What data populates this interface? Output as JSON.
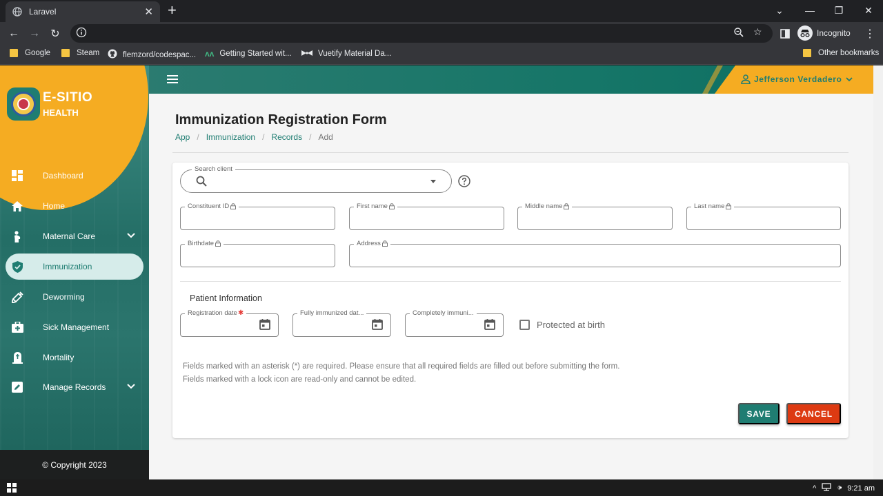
{
  "browser": {
    "tab_title": "Laravel",
    "tab_close": "✕",
    "new_tab": "+",
    "incognito_label": "Incognito",
    "bookmarks": [
      {
        "label": "Google",
        "icon": "folder-icon"
      },
      {
        "label": "Steam",
        "icon": "folder-icon"
      },
      {
        "label": "flemzord/codespac...",
        "icon": "github-icon"
      },
      {
        "label": "Getting Started wit...",
        "icon": "vue-icon"
      },
      {
        "label": "Vuetify Material Da...",
        "icon": "bowtie-icon"
      }
    ],
    "other_bookmarks": "Other bookmarks"
  },
  "sidebar": {
    "brand_name": "E-SITIO",
    "brand_sub": "HEALTH",
    "items": [
      {
        "label": "Dashboard",
        "icon": "dashboard-icon"
      },
      {
        "label": "Home",
        "icon": "home-icon"
      },
      {
        "label": "Maternal Care",
        "icon": "maternal-icon",
        "expandable": true
      },
      {
        "label": "Immunization",
        "icon": "shield-icon",
        "active": true
      },
      {
        "label": "Deworming",
        "icon": "syringe-icon"
      },
      {
        "label": "Sick Management",
        "icon": "medical-bag-icon"
      },
      {
        "label": "Mortality",
        "icon": "tombstone-icon"
      },
      {
        "label": "Manage Records",
        "icon": "edit-icon",
        "expandable": true
      }
    ],
    "copyright": "© Copyright 2023"
  },
  "topbar": {
    "user_name": "Jefferson Verdadero"
  },
  "page": {
    "title": "Immunization Registration Form",
    "breadcrumb": [
      "App",
      "Immunization",
      "Records",
      "Add"
    ]
  },
  "form": {
    "search_label": "Search client",
    "search_value": "",
    "constituent_id": "Constituent ID",
    "first_name": "First name",
    "middle_name": "Middle name",
    "last_name": "Last name",
    "birthdate": "Birthdate",
    "address": "Address",
    "section_title": "Patient Information",
    "registration_date": "Registration date",
    "fully_immunized": "Fully immunized dat...",
    "completely_immunized": "Completely immuni...",
    "protected_at_birth": "Protected at birth",
    "note_required": "Fields marked with an asterisk (*) are required. Please ensure that all required fields are filled out before submitting the form.",
    "note_readonly": "Fields marked with a lock icon are read-only and cannot be edited.",
    "save": "SAVE",
    "cancel": "CANCEL"
  },
  "taskbar": {
    "time": "9:21 am"
  },
  "colors": {
    "primary": "#1f7d72",
    "accent": "#f5ac22",
    "danger": "#dd3a12"
  }
}
